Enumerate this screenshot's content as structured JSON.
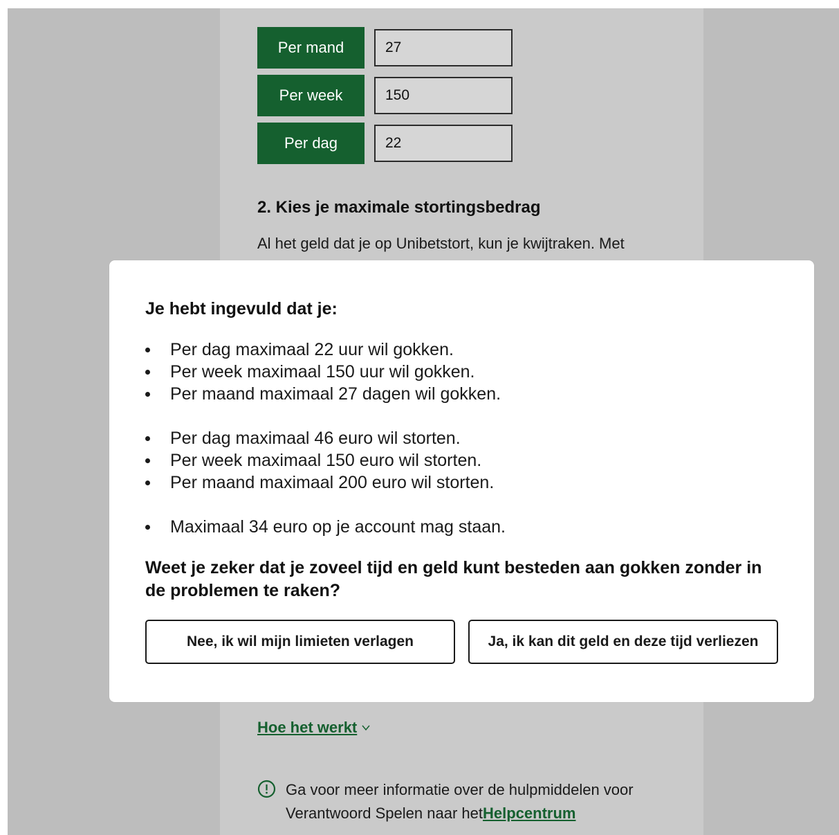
{
  "limits": [
    {
      "label": "Per mand",
      "value": "27"
    },
    {
      "label": "Per week",
      "value": "150"
    },
    {
      "label": "Per dag",
      "value": "22"
    }
  ],
  "deposit_section": {
    "title": "2. Kies je maximale stortingsbedrag",
    "text": "Al het geld dat je op Unibetstort, kun je kwijtraken. Met"
  },
  "modal": {
    "heading": "Je hebt ingevuld dat je:",
    "time_limits": [
      "Per dag maximaal 22 uur wil gokken.",
      "Per week maximaal 150 uur wil gokken.",
      "Per maand maximaal 27 dagen wil gokken."
    ],
    "deposit_limits": [
      "Per dag maximaal 46 euro wil storten.",
      "Per week maximaal 150 euro wil storten.",
      "Per maand maximaal 200 euro wil storten."
    ],
    "balance_limits": [
      "Maximaal 34 euro op je account mag staan."
    ],
    "question": "Weet je zeker dat je zoveel tijd en geld kunt besteden aan gokken zonder in de problemen te raken?",
    "decline_button": "Nee, ik wil mijn limieten verlagen",
    "accept_button": "Ja, ik kan dit geld en deze tijd verliezen"
  },
  "how_it_works": {
    "label": "Hoe het werkt",
    "icon": "chevron-down-icon"
  },
  "info": {
    "icon": "exclamation-circle-icon",
    "text": "Ga voor meer informatie over de hulpmiddelen voor Verantwoord Spelen naar het",
    "link": "Helpcentrum"
  },
  "colors": {
    "brand_green": "#15602f",
    "overlay_gray": "#bdbdbd"
  }
}
